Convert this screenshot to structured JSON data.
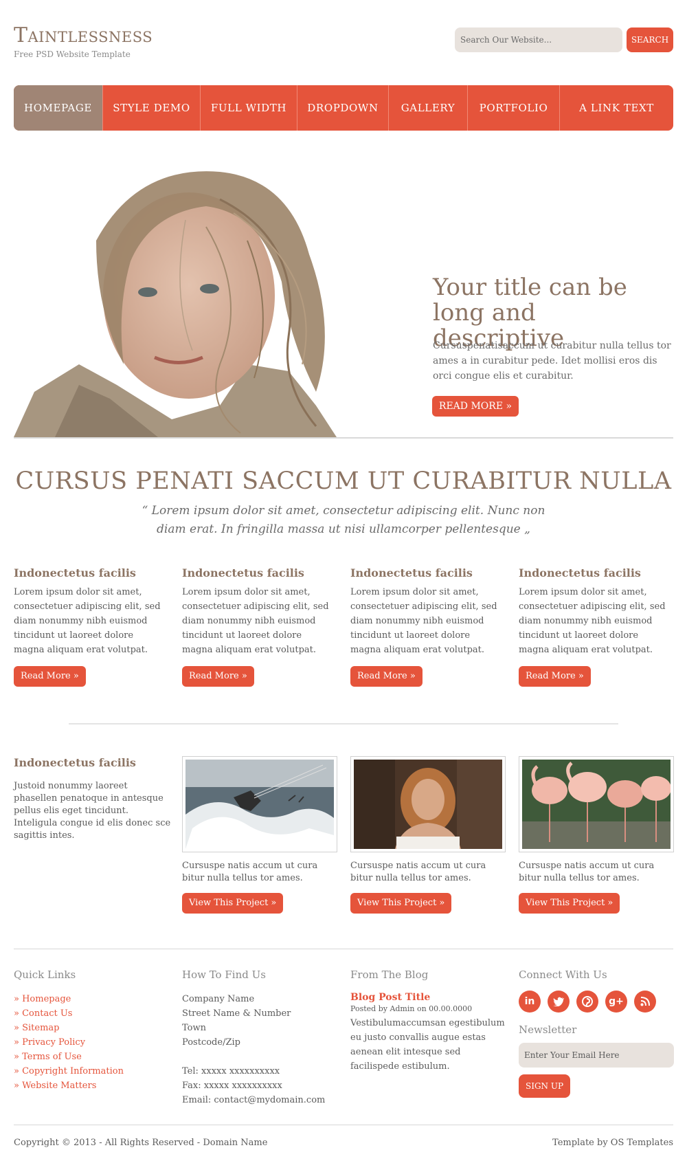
{
  "header": {
    "site_title": "Taintlessness",
    "tagline": "Free PSD Website Template",
    "search_placeholder": "Search Our Website...",
    "search_button": "SEARCH"
  },
  "nav": {
    "items": [
      "HOMEPAGE",
      "STYLE DEMO",
      "FULL WIDTH",
      "DROPDOWN",
      "GALLERY",
      "PORTFOLIO",
      "A LINK TEXT"
    ],
    "active_index": 0
  },
  "hero": {
    "title": "Your title can be long and descriptive",
    "text": "Cursuspenatisaccum ut curabitur nulla tellus tor ames a in curabitur pede. Idet mollisi eros dis orci congue elis et curabitur.",
    "button": "READ MORE »"
  },
  "intro": {
    "title": "CURSUS PENATI SACCUM UT CURABITUR NULLA",
    "quote": "“ Lorem ipsum dolor sit amet, consectetur adipiscing elit. Nunc non diam erat. In fringilla massa ut nisi ullamcorper pellentesque „"
  },
  "columns": [
    {
      "title": "Indonectetus facilis",
      "text": "Lorem ipsum dolor sit amet, consectetuer adipiscing elit, sed diam nonummy nibh euismod tincidunt ut laoreet dolore magna aliquam erat volutpat.",
      "button": "Read More »"
    },
    {
      "title": "Indonectetus facilis",
      "text": "Lorem ipsum dolor sit amet, consectetuer adipiscing elit, sed diam nonummy nibh euismod tincidunt ut laoreet dolore magna aliquam erat volutpat.",
      "button": "Read More »"
    },
    {
      "title": "Indonectetus facilis",
      "text": "Lorem ipsum dolor sit amet, consectetuer adipiscing elit, sed diam nonummy nibh euismod tincidunt ut laoreet dolore magna aliquam erat volutpat.",
      "button": "Read More »"
    },
    {
      "title": "Indonectetus facilis",
      "text": "Lorem ipsum dolor sit amet, consectetuer adipiscing elit, sed diam nonummy nibh euismod tincidunt ut laoreet dolore magna aliquam erat volutpat.",
      "button": "Read More »"
    }
  ],
  "projects": {
    "title": "Indonectetus facilis",
    "text": "Justoid nonummy laoreet phasellen penatoque in antesque pellus elis eget tincidunt. Inteligula congue id elis donec sce sagittis intes.",
    "items": [
      {
        "caption": "Cursuspe natis accum ut cura bitur nulla tellus tor ames.",
        "button": "View This Project »"
      },
      {
        "caption": "Cursuspe natis accum ut cura bitur nulla tellus tor ames.",
        "button": "View This Project »"
      },
      {
        "caption": "Cursuspe natis accum ut cura bitur nulla tellus tor ames.",
        "button": "View This Project »"
      }
    ]
  },
  "footer": {
    "quick_links_title": "Quick Links",
    "quick_links": [
      "» Homepage",
      "» Contact Us",
      "» Sitemap",
      "» Privacy Policy",
      "» Terms of Use",
      "» Copyright Information",
      "» Website Matters"
    ],
    "find_us_title": "How To Find Us",
    "address": [
      "Company Name",
      "Street Name & Number",
      "Town",
      "Postcode/Zip"
    ],
    "tel": "Tel: xxxxx xxxxxxxxxx",
    "fax": "Fax: xxxxx xxxxxxxxxx",
    "email": "Email: contact@mydomain.com",
    "blog_title": "From The Blog",
    "blog_post_title": "Blog Post Title",
    "blog_meta": "Posted by Admin on 00.00.0000",
    "blog_text": "Vestibulumaccumsan egestibulum eu justo convallis augue estas aenean elit intesque sed facilispede estibulum.",
    "connect_title": "Connect With Us",
    "social_icons": [
      "linkedin-icon",
      "twitter-icon",
      "pinterest-icon",
      "google-plus-icon",
      "rss-icon"
    ],
    "newsletter_title": "Newsletter",
    "newsletter_placeholder": "Enter Your Email Here",
    "newsletter_button": "SIGN UP"
  },
  "bottom": {
    "copyright": "Copyright © 2013 - All Rights Reserved - Domain Name",
    "credit": "Template by OS Templates"
  },
  "colors": {
    "accent": "#e5543b",
    "brown": "#8c7463",
    "nav_active": "#a08575",
    "input_bg": "#e8e2dd"
  }
}
